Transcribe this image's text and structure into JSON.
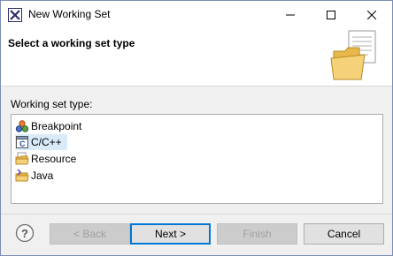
{
  "window": {
    "title": "New Working Set"
  },
  "banner": {
    "title": "Select a working set type"
  },
  "content": {
    "list_label": "Working set type:",
    "items": [
      {
        "label": "Breakpoint",
        "icon": "breakpoint-icon",
        "selected": false
      },
      {
        "label": "C/C++",
        "icon": "c-cpp-icon",
        "selected": true
      },
      {
        "label": "Resource",
        "icon": "resource-folder-icon",
        "selected": false
      },
      {
        "label": "Java",
        "icon": "java-folder-icon",
        "selected": false
      }
    ]
  },
  "buttons": {
    "back": "< Back",
    "next": "Next >",
    "finish": "Finish",
    "cancel": "Cancel"
  },
  "colors": {
    "selection": "#d9ebf9",
    "accent": "#0078d7"
  }
}
